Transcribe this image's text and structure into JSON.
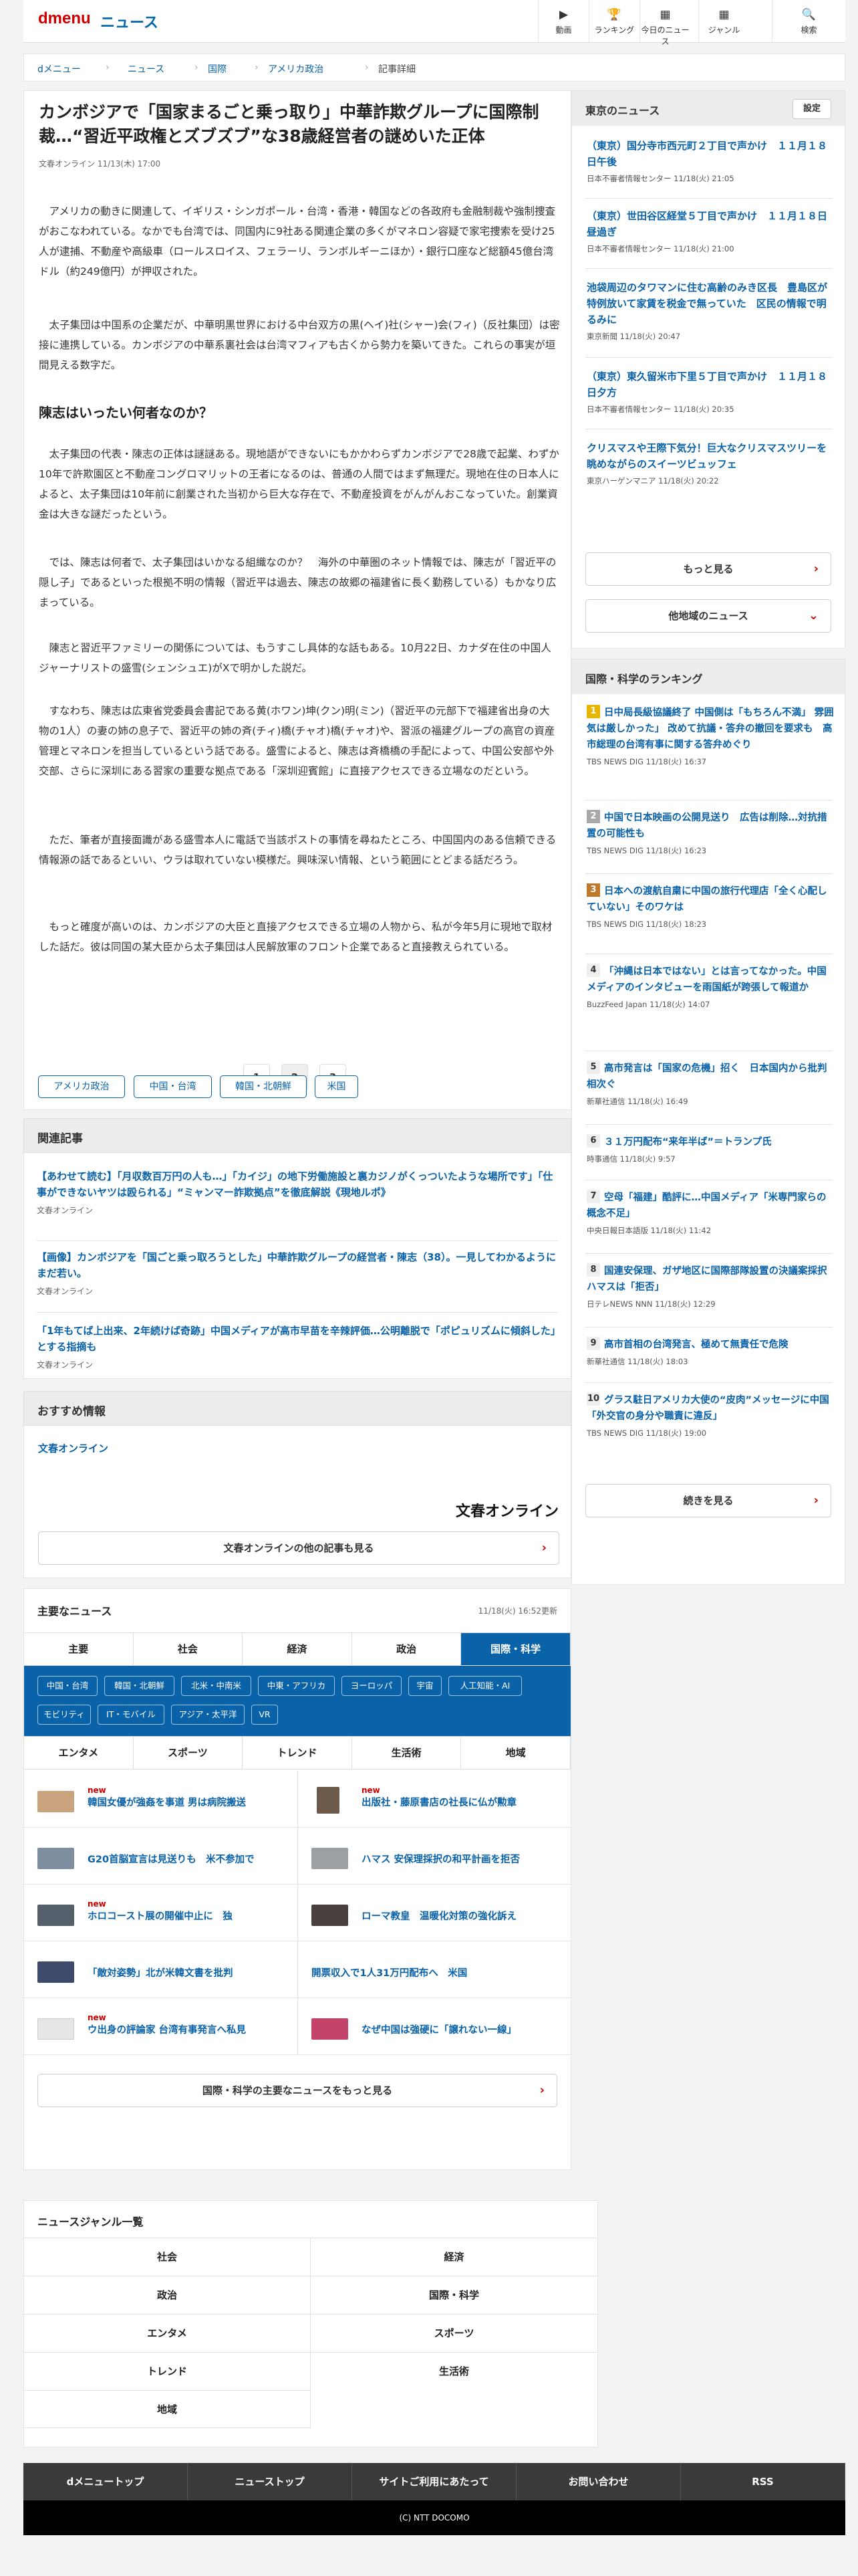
{
  "header": {
    "logo": "dmenu",
    "site": "ニュース",
    "nav": [
      "動画",
      "ランキング",
      "今日のニュース",
      "ジャンル",
      "検索"
    ]
  },
  "breadcrumb": [
    "dメニュー",
    "ニュース",
    "国際",
    "アメリカ政治",
    "記事詳細"
  ],
  "article": {
    "title": "カンボジアで「国家まるごと乗っ取り」中華詐欺グループに国際制裁…“習近平政権とズブズブ”な38歳経営者の謎めいた正体",
    "meta": "文春オンライン 11/13(木) 17:00",
    "paragraphs": [
      "アメリカの動きに関連して、イギリス・シンガポール・台湾・香港・韓国などの各政府も金融制裁や強制捜査がおこなわれている。なかでも台湾では、同国内に9社ある関連企業の多くがマネロン容疑で家宅捜索を受け25人が逮捕、不動産や高級車（ロールスロイス、フェラーリ、ランボルギーニほか）・銀行口座など総額45億台湾ドル（約249億円）が押収された。",
      "太子集団は中国系の企業だが、中華明黒世界における中台双方の黒(ヘイ)社(シャー)会(フィ)（反社集団）は密接に連携している。カンボジアの中華系裏社会は台湾マフィアも古くから勢力を築いてきた。これらの事実が垣間見える数字だ。",
      "太子集団の代表・陳志の正体は謎謎ある。現地語ができないにもかかわらずカンボジアで28歳で起業、わずか10年で許欺園区と不動産コングロマリットの王者になるのは、普通の人間ではまず無理だ。現地在住の日本人によると、太子集団は10年前に創業された当初から巨大な存在で、不動産投資をがんがんおこなっていた。創業資金は大きな謎だったという。",
      "では、陳志は何者で、太子集団はいかなる組織なのか？　海外の中華圏のネット情報では、陳志が「習近平の隠し子」であるといった根拠不明の情報（習近平は過去、陳志の故郷の福建省に長く勤務している）もかなり広まっている。",
      "陳志と習近平ファミリーの関係については、もうすこし具体的な話もある。10月22日、カナダ在住の中国人ジャーナリストの盛雪(シェンシュエ)がXで明かした説だ。",
      "すなわち、陳志は広東省党委員会書記である黄(ホワン)坤(クン)明(ミン)（習近平の元部下で福建省出身の大物の1人）の妻の姉の息子で、習近平の姉の斉(チィ)橋(チャオ)橋(チャオ)や、習派の福建グループの高官の資産管理とマネロンを担当しているという話である。盛雪によると、陳志は斉橋橋の手配によって、中国公安部や外交部、さらに深圳にある習家の重要な拠点である「深圳迎賓館」に直接アクセスできる立場なのだという。",
      "ただ、筆者が直接面識がある盛雪本人に電話で当該ポストの事情を尋ねたところ、中国国内のある信頼できる情報源の話であるといい、ウラは取れていない模様だ。興味深い情報、という範囲にとどまる話だろう。",
      "もっと確度が高いのは、カンボジアの大臣と直接アクセスできる立場の人物から、私が今年5月に現地で取材した話だ。彼は同国の某大臣から太子集団は人民解放軍のフロント企業であると直接教えられている。"
    ],
    "subheading": "陳志はいったい何者なのか？",
    "pages": [
      "1",
      "2",
      "3"
    ],
    "tags": [
      "アメリカ政治",
      "中国・台湾",
      "韓国・北朝鮮",
      "米国"
    ]
  },
  "related": {
    "heading": "関連記事",
    "items": [
      {
        "title": "【あわせて読む】「月収数百万円の人も…」「カイジ」の地下労働施設と裏カジノがくっついたような場所です」「仕事ができないヤツは殴られる」“ミャンマー詐欺拠点”を徹底解説《現地ルポ》",
        "source": "文春オンライン"
      },
      {
        "title": "【画像】カンボジアを「国ごと乗っ取ろうとした」中華詐欺グループの経営者・陳志（38）。一見してわかるようにまだ若い。",
        "source": "文春オンライン"
      },
      {
        "title": "「1年もてば上出来、2年続けば奇跡」中国メディアが高市早苗を辛辣評価…公明離脱で「ポピュリズムに傾斜した」とする指摘も",
        "source": "文春オンライン"
      }
    ]
  },
  "recommend": {
    "heading": "おすすめ情報",
    "link": "文春オンライン",
    "logo": "文春オンライン",
    "button": "文春オンラインの他の記事も見る"
  },
  "major": {
    "heading": "主要なニュース",
    "updated": "11/18(火) 16:52更新",
    "tabs1": [
      "主要",
      "社会",
      "経済",
      "政治",
      "国際・科学"
    ],
    "subtabs": [
      "中国・台湾",
      "韓国・北朝鮮",
      "北米・中南米",
      "中東・アフリカ",
      "ヨーロッパ",
      "宇宙",
      "人工知能・AI",
      "モビリティ",
      "IT・モバイル",
      "アジア・太平洋",
      "VR"
    ],
    "tabs2": [
      "エンタメ",
      "スポーツ",
      "トレンド",
      "生活術",
      "地域"
    ],
    "new_label": "new",
    "items": [
      {
        "title": "韓国女優が強姦を事道 男は病院搬送",
        "new": true,
        "img": true
      },
      {
        "title": "出版社・藤原書店の社長に仏が勲章",
        "new": true,
        "img": true
      },
      {
        "title": "G20首脳宣言は見送りも　米不参加で",
        "new": false,
        "img": true
      },
      {
        "title": "ハマス 安保理採択の和平計画を拒否",
        "new": false,
        "img": true
      },
      {
        "title": "ホロコースト展の開催中止に　独",
        "new": true,
        "img": true
      },
      {
        "title": "ローマ教皇　温暖化対策の強化訴え",
        "new": false,
        "img": true
      },
      {
        "title": "「敵対姿勢」北が米韓文書を批判",
        "new": false,
        "img": true
      },
      {
        "title": "開票収入で1人31万円配布へ　米国",
        "new": false,
        "img": false
      },
      {
        "title": "ウ出身の評論家 台湾有事発言へ私見",
        "new": true,
        "img": true
      },
      {
        "title": "なぜ中国は強硬に「譲れない一線」",
        "new": false,
        "img": true
      }
    ],
    "more": "国際・科学の主要なニュースをもっと見る"
  },
  "genre": {
    "heading": "ニュースジャンル一覧",
    "items": [
      "社会",
      "経済",
      "政治",
      "国際・科学",
      "エンタメ",
      "スポーツ",
      "トレンド",
      "生活術",
      "地域"
    ]
  },
  "footer": {
    "links": [
      "dメニュートップ",
      "ニューストップ",
      "サイトご利用にあたって",
      "お問い合わせ",
      "RSS"
    ],
    "copyright": "(C) NTT DOCOMO"
  },
  "tokyo": {
    "heading": "東京のニュース",
    "setting": "設定",
    "items": [
      {
        "title": "（東京）国分寺市西元町２丁目で声かけ　１１月１８日午後",
        "source": "日本不審者情報センター 11/18(火) 21:05"
      },
      {
        "title": "（東京）世田谷区経堂５丁目で声かけ　１１月１８日昼過ぎ",
        "source": "日本不審者情報センター 11/18(火) 21:00"
      },
      {
        "title": "池袋周辺のタワマンに住む高齢のみき区長　豊島区が特例放いて家賃を税金で無っていた　区民の情報で明るみに",
        "source": "東京新聞 11/18(火) 20:47"
      },
      {
        "title": "（東京）東久留米市下里５丁目で声かけ　１１月１８日夕方",
        "source": "日本不審者情報センター 11/18(火) 20:35"
      },
      {
        "title": "クリスマスや王際下気分！巨大なクリスマスツリーを眺めながらのスイーツビュッフェ",
        "source": "東京ハーゲンマニア 11/18(火) 20:22"
      }
    ],
    "more": "もっと見る",
    "other": "他地域のニュース"
  },
  "ranking": {
    "heading": "国際・科学のランキング",
    "items": [
      {
        "rank": "1",
        "title": "日中局長級協議終了 中国側は「もちろん不満」 雰囲気は厳しかった」 改めて抗議・答弁の撤回を要求も　高市総理の台湾有事に関する答弁めぐり",
        "source": "TBS NEWS DIG 11/18(火) 16:37"
      },
      {
        "rank": "2",
        "title": "中国で日本映画の公開見送り　広告は削除…対抗措置の可能性も",
        "source": "TBS NEWS DIG 11/18(火) 16:23"
      },
      {
        "rank": "3",
        "title": "日本への渡航自粛に中国の旅行代理店「全く心配していない」そのワケは",
        "source": "TBS NEWS DIG 11/18(火) 18:23"
      },
      {
        "rank": "4",
        "title": "「沖縄は日本ではない」とは言ってなかった。中国メディアのインタビューを雨国紙が跨張して報道か",
        "source": "BuzzFeed Japan 11/18(火) 14:07"
      },
      {
        "rank": "5",
        "title": "高市発言は「国家の危機」招く　日本国内から批判相次ぐ",
        "source": "新華社通信 11/18(火) 16:49"
      },
      {
        "rank": "6",
        "title": "３１万円配布“来年半ば”＝トランプ氏",
        "source": "時事通信 11/18(火) 9:57"
      },
      {
        "rank": "7",
        "title": "空母「福建」酷評に…中国メディア「米専門家らの概念不足」",
        "source": "中央日報日本語版 11/18(火) 11:42"
      },
      {
        "rank": "8",
        "title": "国連安保理、ガザ地区に国際部隊設置の決議案採択　ハマスは「拒否」",
        "source": "日テレNEWS NNN 11/18(火) 12:29"
      },
      {
        "rank": "9",
        "title": "高市首相の台湾発言、極めて無責任で危険",
        "source": "新華社通信 11/18(火) 18:03"
      },
      {
        "rank": "10",
        "title": "グラス駐日アメリカ大使の“皮肉”メッセージに中国「外交官の身分や職責に違反」",
        "source": "TBS NEWS DIG 11/18(火) 19:00"
      }
    ],
    "more": "続きを見る"
  }
}
